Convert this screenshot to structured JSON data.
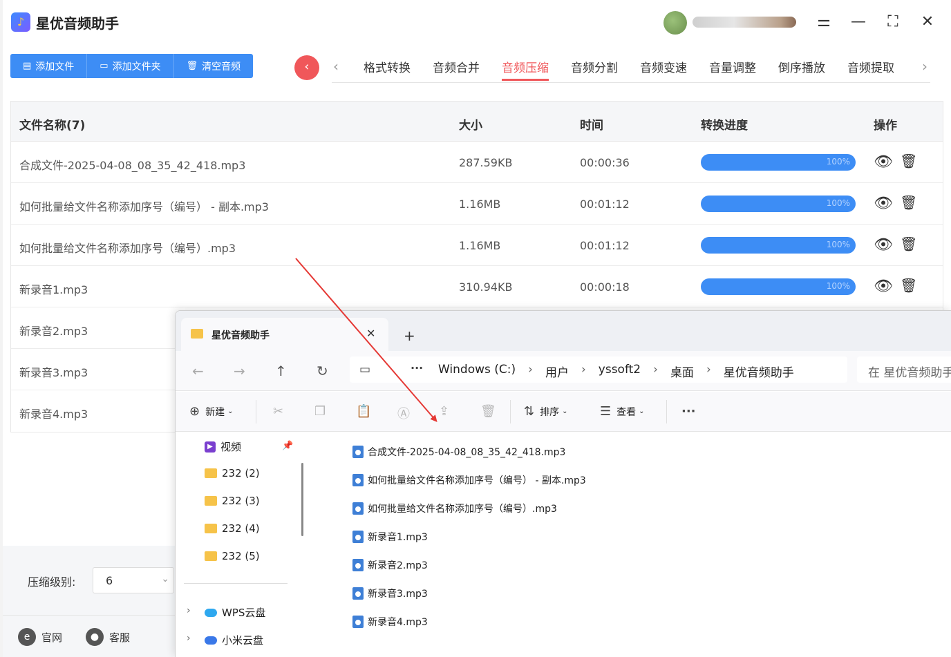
{
  "app": {
    "title": "星优音频助手"
  },
  "toolbar": {
    "add_file": "添加文件",
    "add_folder": "添加文件夹",
    "clear_audio": "清空音频"
  },
  "tabs": [
    {
      "label": "格式转换"
    },
    {
      "label": "音频合并"
    },
    {
      "label": "音频压缩",
      "active": true
    },
    {
      "label": "音频分割"
    },
    {
      "label": "音频变速"
    },
    {
      "label": "音量调整"
    },
    {
      "label": "倒序播放"
    },
    {
      "label": "音频提取"
    }
  ],
  "table": {
    "headers": {
      "name": "文件名称(7)",
      "size": "大小",
      "time": "时间",
      "progress": "转换进度",
      "ops": "操作"
    },
    "rows": [
      {
        "name": "合成文件-2025-04-08_08_35_42_418.mp3",
        "size": "287.59KB",
        "time": "00:00:36",
        "progress": "100%",
        "progress_value": 1.0
      },
      {
        "name": "如何批量给文件名称添加序号（编号） - 副本.mp3",
        "size": "1.16MB",
        "time": "00:01:12",
        "progress": "100%",
        "progress_value": 1.0
      },
      {
        "name": "如何批量给文件名称添加序号（编号）.mp3",
        "size": "1.16MB",
        "time": "00:01:12",
        "progress": "100%",
        "progress_value": 1.0
      },
      {
        "name": "新录音1.mp3",
        "size": "310.94KB",
        "time": "00:00:18",
        "progress": "100%",
        "progress_value": 1.0
      },
      {
        "name": "新录音2.mp3"
      },
      {
        "name": "新录音3.mp3"
      },
      {
        "name": "新录音4.mp3"
      }
    ]
  },
  "compress": {
    "label": "压缩级别:",
    "value": "6"
  },
  "footer": {
    "website": "官网",
    "support": "客服"
  },
  "explorer": {
    "tab_title": "星优音频助手",
    "breadcrumbs": [
      "Windows (C:)",
      "用户",
      "yssoft2",
      "桌面",
      "星优音频助手"
    ],
    "search_placeholder": "在 星优音频助手",
    "commands": {
      "new": "新建",
      "sort": "排序",
      "view": "查看"
    },
    "sidebar": [
      {
        "label": "视频",
        "icon": "video-icon"
      },
      {
        "label": "232 (2)",
        "icon": "folder-icon"
      },
      {
        "label": "232 (3)",
        "icon": "folder-icon"
      },
      {
        "label": "232 (4)",
        "icon": "folder-icon"
      },
      {
        "label": "232 (5)",
        "icon": "folder-icon"
      },
      {
        "label": "WPS云盘",
        "icon": "cloud-icon"
      },
      {
        "label": "小米云盘",
        "icon": "cloud-icon"
      }
    ],
    "files": [
      "合成文件-2025-04-08_08_35_42_418.mp3",
      "如何批量给文件名称添加序号（编号） - 副本.mp3",
      "如何批量给文件名称添加序号（编号）.mp3",
      "新录音1.mp3",
      "新录音2.mp3",
      "新录音3.mp3",
      "新录音4.mp3"
    ]
  },
  "colors": {
    "accent": "#3d8df5",
    "active_tab": "#f0575a",
    "arrow": "#e53935"
  }
}
